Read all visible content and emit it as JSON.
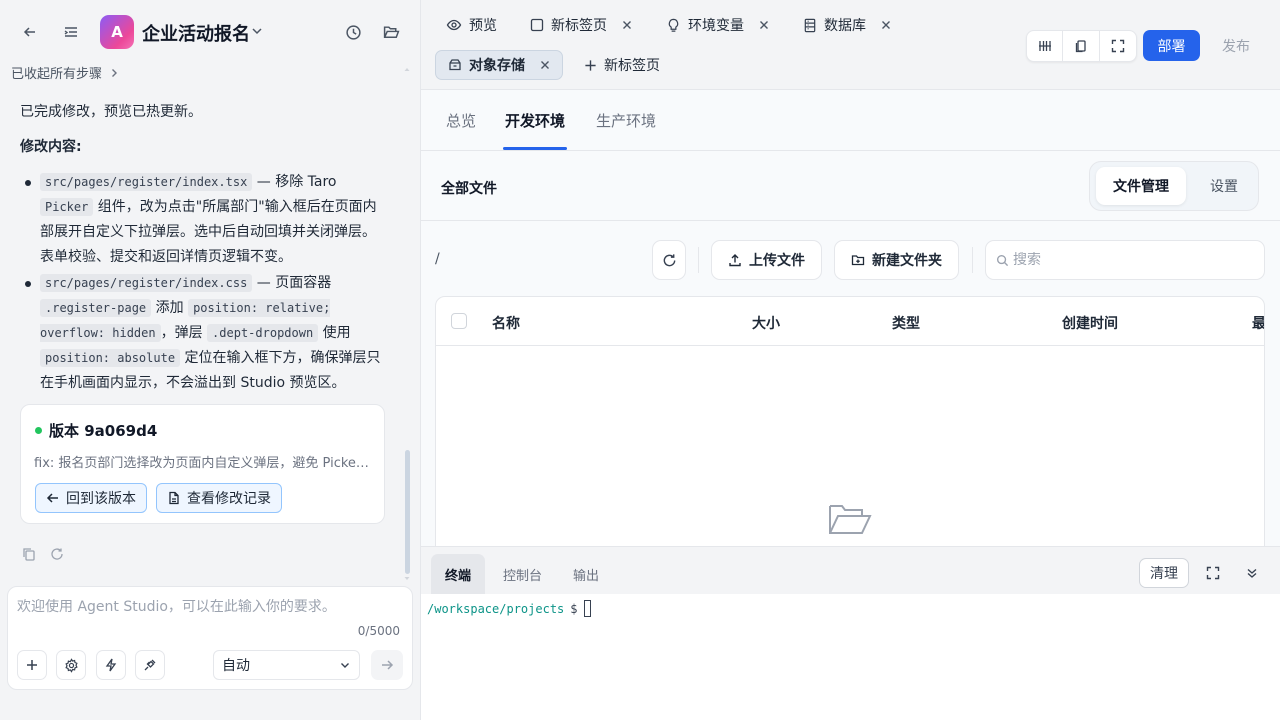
{
  "app": {
    "logo_letter": "A",
    "title": "企业活动报名"
  },
  "chat": {
    "collapse_label": "已收起所有步骤",
    "intro": "已完成修改，预览已热更新。",
    "changes_heading": "修改内容:",
    "bullet1": {
      "code1": "src/pages/register/index.tsx",
      "text1": " — 移除 Taro ",
      "code2": "Picker",
      "text2": " 组件，改为点击\"所属部门\"输入框后在页面内部展开自定义下拉弹层。选中后自动回填并关闭弹层。表单校验、提交和返回详情页逻辑不变。"
    },
    "bullet2": {
      "code1": "src/pages/register/index.css",
      "text1": " — 页面容器 ",
      "code2": ".register-page",
      "text2": " 添加 ",
      "code3": "position: relative; overflow: hidden",
      "text3": "，弹层 ",
      "code4": ".dept-dropdown",
      "text4": " 使用 ",
      "code5": "position: absolute",
      "text5": " 定位在输入框下方，确保弹层只在手机画面内显示，不会溢出到 Studio 预览区。"
    },
    "version": {
      "title": "版本 9a069d4",
      "desc": "fix: 报名页部门选择改为页面内自定义弹层，避免 Picker 溢出到预览区",
      "revert_label": "回到该版本",
      "history_label": "查看修改记录",
      "status_color": "#22c55e"
    }
  },
  "composer": {
    "placeholder": "欢迎使用 Agent Studio，可以在此输入你的要求。",
    "value": "",
    "char_count": "0/5000",
    "mode": "自动"
  },
  "tabs": [
    {
      "label": "预览",
      "icon": "eye-icon"
    },
    {
      "label": "新标签页",
      "icon": "square-icon"
    },
    {
      "label": "环境变量",
      "icon": "bulb-icon"
    },
    {
      "label": "数据库",
      "icon": "database-icon"
    },
    {
      "label": "对象存储",
      "icon": "storage-icon"
    }
  ],
  "new_tab_label": "新标签页",
  "actions": {
    "deploy": "部署",
    "publish": "发布"
  },
  "env_tabs": [
    "总览",
    "开发环境",
    "生产环境"
  ],
  "files": {
    "title": "全部文件",
    "seg_files": "文件管理",
    "seg_settings": "设置",
    "path": "/",
    "upload": "上传文件",
    "new_folder": "新建文件夹",
    "search_placeholder": "搜索",
    "columns": [
      "名称",
      "大小",
      "类型",
      "创建时间",
      "最"
    ]
  },
  "terminal": {
    "tabs": [
      "终端",
      "控制台",
      "输出"
    ],
    "clear": "清理",
    "path": "/workspace/projects",
    "prompt": "$"
  },
  "colors": {
    "accent": "#2563eb",
    "terminal_path": "#0d9488"
  }
}
